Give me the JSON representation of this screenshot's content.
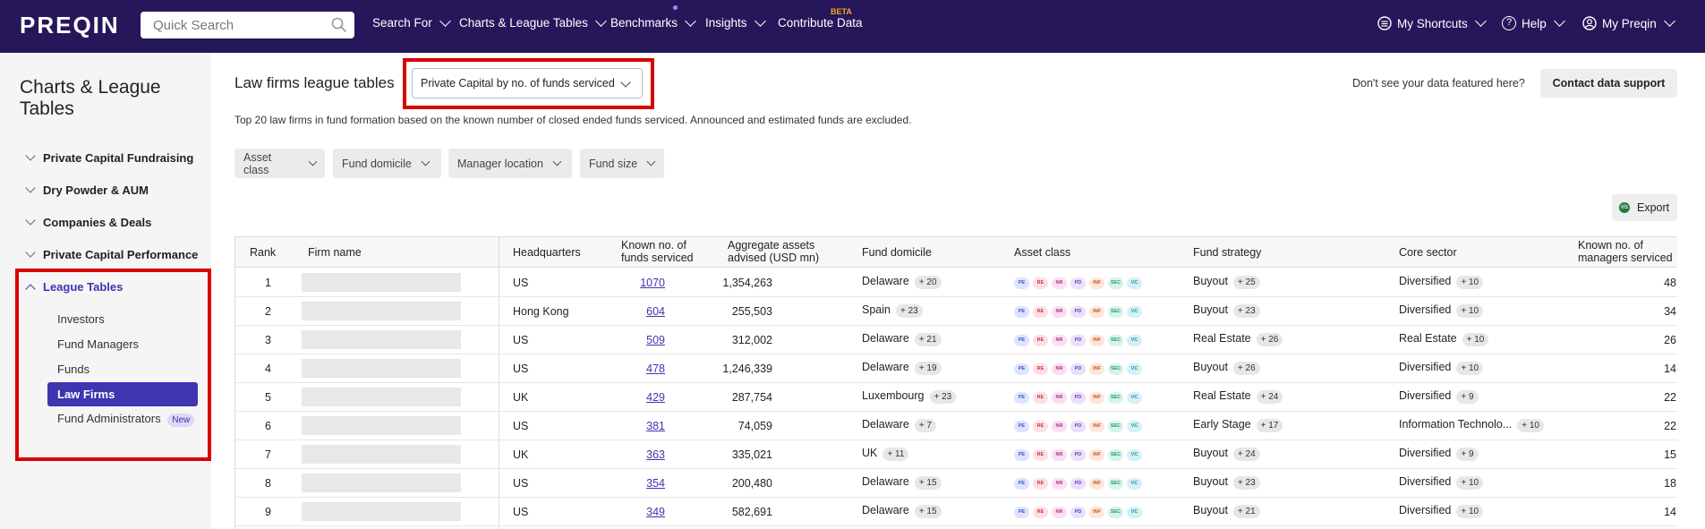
{
  "nav": {
    "logo": "PREQIN",
    "search_placeholder": "Quick Search",
    "items": [
      {
        "label": "Search For"
      },
      {
        "label": "Charts & League Tables"
      },
      {
        "label": "Benchmarks"
      },
      {
        "label": "Insights"
      },
      {
        "label": "Contribute Data",
        "badge": "BETA"
      }
    ],
    "right": [
      {
        "label": "My Shortcuts"
      },
      {
        "label": "Help",
        "icon": "?"
      },
      {
        "label": "My Preqin"
      }
    ]
  },
  "sidebar": {
    "title": "Charts & League Tables",
    "sections": [
      {
        "label": "Private Capital Fundraising"
      },
      {
        "label": "Dry Powder & AUM"
      },
      {
        "label": "Companies & Deals"
      },
      {
        "label": "Private Capital Performance"
      },
      {
        "label": "League Tables"
      }
    ],
    "sub_items": [
      {
        "label": "Investors"
      },
      {
        "label": "Fund Managers"
      },
      {
        "label": "Funds"
      },
      {
        "label": "Law Firms"
      },
      {
        "label": "Fund Administrators",
        "badge": "New"
      }
    ]
  },
  "main": {
    "title": "Law firms league tables",
    "dropdown_value": "Private Capital by no. of funds serviced",
    "no_data_text": "Don't see your data featured here?",
    "contact_button": "Contact data support",
    "description": "Top 20 law firms in fund formation based on the known number of closed ended funds serviced. Announced and estimated funds are excluded.",
    "filters": [
      "Asset class",
      "Fund domicile",
      "Manager location",
      "Fund size"
    ],
    "export_label": "Export",
    "export_icon_text": "xls"
  },
  "table": {
    "headers": {
      "rank": "Rank",
      "firm": "Firm name",
      "hq": "Headquarters",
      "funds_l1": "Known no. of",
      "funds_l2": "funds serviced",
      "aum_l1": "Aggregate assets",
      "aum_l2": "advised (USD mn)",
      "domicile": "Fund domicile",
      "asset": "Asset class",
      "strategy": "Fund strategy",
      "sector": "Core sector",
      "mgr_l1": "Known no. of",
      "mgr_l2": "managers serviced"
    },
    "asset_chips": [
      "PE",
      "RE",
      "NR",
      "PD",
      "INF",
      "SEC",
      "VC"
    ],
    "chip_colors": [
      {
        "bg": "#dfe3ff",
        "fg": "#3a52c8"
      },
      {
        "bg": "#fde0e4",
        "fg": "#c8324e"
      },
      {
        "bg": "#fbdff1",
        "fg": "#b2308d"
      },
      {
        "bg": "#e9e0fb",
        "fg": "#6e3fc2"
      },
      {
        "bg": "#fde6da",
        "fg": "#c85a1e"
      },
      {
        "bg": "#d8f3ec",
        "fg": "#1f9a78"
      },
      {
        "bg": "#d6f1f6",
        "fg": "#1a8aa0"
      }
    ],
    "rows": [
      {
        "rank": "1",
        "hq": "US",
        "funds": "1070",
        "aum": "1,354,263",
        "dom": "Delaware",
        "dom_b": "+ 20",
        "strat": "Buyout",
        "strat_b": "+ 25",
        "sector": "Diversified",
        "sector_b": "+ 10",
        "mgrs": "48"
      },
      {
        "rank": "2",
        "hq": "Hong Kong",
        "funds": "604",
        "aum": "255,503",
        "dom": "Spain",
        "dom_b": "+ 23",
        "strat": "Buyout",
        "strat_b": "+ 23",
        "sector": "Diversified",
        "sector_b": "+ 10",
        "mgrs": "34"
      },
      {
        "rank": "3",
        "hq": "US",
        "funds": "509",
        "aum": "312,002",
        "dom": "Delaware",
        "dom_b": "+ 21",
        "strat": "Real Estate",
        "strat_b": "+ 26",
        "sector": "Real Estate",
        "sector_b": "+ 10",
        "mgrs": "26"
      },
      {
        "rank": "4",
        "hq": "US",
        "funds": "478",
        "aum": "1,246,339",
        "dom": "Delaware",
        "dom_b": "+ 19",
        "strat": "Buyout",
        "strat_b": "+ 26",
        "sector": "Diversified",
        "sector_b": "+ 10",
        "mgrs": "14"
      },
      {
        "rank": "5",
        "hq": "UK",
        "funds": "429",
        "aum": "287,754",
        "dom": "Luxembourg",
        "dom_b": "+ 23",
        "strat": "Real Estate",
        "strat_b": "+ 24",
        "sector": "Diversified",
        "sector_b": "+ 9",
        "mgrs": "22"
      },
      {
        "rank": "6",
        "hq": "US",
        "funds": "381",
        "aum": "74,059",
        "dom": "Delaware",
        "dom_b": "+ 7",
        "strat": "Early Stage",
        "strat_b": "+ 17",
        "sector": "Information Technolo...",
        "sector_b": "+ 10",
        "mgrs": "22"
      },
      {
        "rank": "7",
        "hq": "UK",
        "funds": "363",
        "aum": "335,021",
        "dom": "UK",
        "dom_b": "+ 11",
        "strat": "Buyout",
        "strat_b": "+ 24",
        "sector": "Diversified",
        "sector_b": "+ 9",
        "mgrs": "15"
      },
      {
        "rank": "8",
        "hq": "US",
        "funds": "354",
        "aum": "200,480",
        "dom": "Delaware",
        "dom_b": "+ 15",
        "strat": "Buyout",
        "strat_b": "+ 23",
        "sector": "Diversified",
        "sector_b": "+ 10",
        "mgrs": "18"
      },
      {
        "rank": "9",
        "hq": "US",
        "funds": "349",
        "aum": "582,691",
        "dom": "Delaware",
        "dom_b": "+ 15",
        "strat": "Buyout",
        "strat_b": "+ 21",
        "sector": "Diversified",
        "sector_b": "+ 10",
        "mgrs": "14"
      }
    ]
  }
}
